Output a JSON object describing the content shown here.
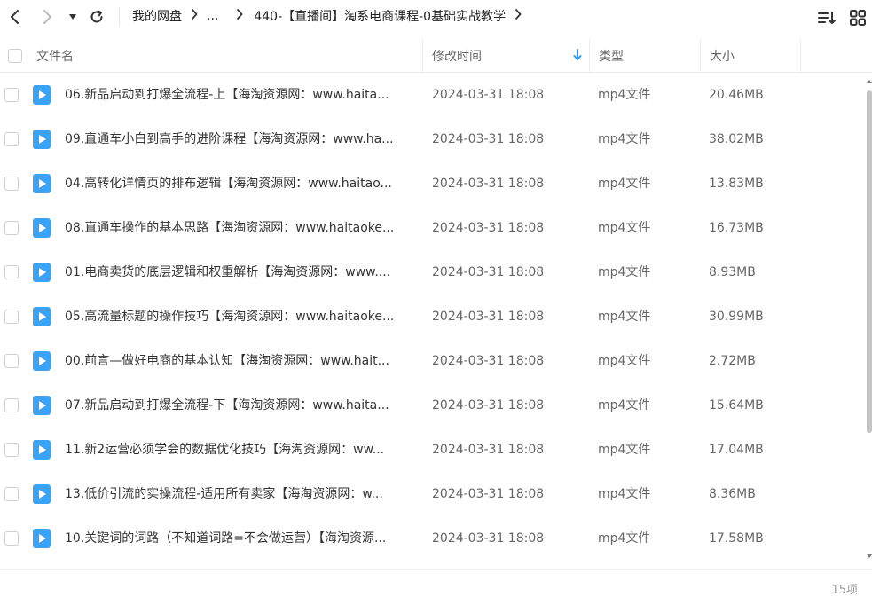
{
  "toolbar": {
    "breadcrumb": [
      {
        "label": "我的网盘"
      },
      {
        "label": "..."
      },
      {
        "label": "440-【直播间】淘系电商课程-0基础实战教学"
      }
    ]
  },
  "header": {
    "name_label": "文件名",
    "time_label": "修改时间",
    "type_label": "类型",
    "size_label": "大小"
  },
  "files": [
    {
      "name": "06.新品启动到打爆全流程-上【海淘资源网：www.haita...",
      "time": "2024-03-31 18:08",
      "type": "mp4文件",
      "size": "20.46MB"
    },
    {
      "name": "09.直通车小白到高手的进阶课程【海淘资源网：www.ha...",
      "time": "2024-03-31 18:08",
      "type": "mp4文件",
      "size": "38.02MB"
    },
    {
      "name": "04.高转化详情页的排布逻辑【海淘资源网：www.haitao...",
      "time": "2024-03-31 18:08",
      "type": "mp4文件",
      "size": "13.83MB"
    },
    {
      "name": "08.直通车操作的基本思路【海淘资源网：www.haitaoke...",
      "time": "2024-03-31 18:08",
      "type": "mp4文件",
      "size": "16.73MB"
    },
    {
      "name": "01.电商卖货的底层逻辑和权重解析【海淘资源网：www....",
      "time": "2024-03-31 18:08",
      "type": "mp4文件",
      "size": "8.93MB"
    },
    {
      "name": "05.高流量标题的操作技巧【海淘资源网：www.haitaoke...",
      "time": "2024-03-31 18:08",
      "type": "mp4文件",
      "size": "30.99MB"
    },
    {
      "name": "00.前言—做好电商的基本认知【海淘资源网：www.hait...",
      "time": "2024-03-31 18:08",
      "type": "mp4文件",
      "size": "2.72MB"
    },
    {
      "name": "07.新品启动到打爆全流程-下【海淘资源网：www.haita...",
      "time": "2024-03-31 18:08",
      "type": "mp4文件",
      "size": "15.64MB"
    },
    {
      "name": "11.新2运营必须学会的数据优化技巧【海淘资源网：ww...",
      "time": "2024-03-31 18:08",
      "type": "mp4文件",
      "size": "17.04MB"
    },
    {
      "name": "13.低价引流的实操流程-适用所有卖家【海淘资源网：w...",
      "time": "2024-03-31 18:08",
      "type": "mp4文件",
      "size": "8.36MB"
    },
    {
      "name": "10.关键词的词路（不知道词路=不会做运营）【海淘资源...",
      "time": "2024-03-31 18:08",
      "type": "mp4文件",
      "size": "17.58MB"
    }
  ],
  "footer": {
    "count": "15项"
  },
  "icons": {
    "file_icon": "video-file-icon",
    "back": "chevron-left-icon",
    "forward": "chevron-right-icon",
    "refresh": "refresh-icon",
    "sort": "sort-list-icon",
    "grid": "grid-view-icon"
  },
  "colors": {
    "accent": "#2f9bf7",
    "file_icon": "#3aa3f5",
    "text": "#333333",
    "muted": "#666666"
  }
}
